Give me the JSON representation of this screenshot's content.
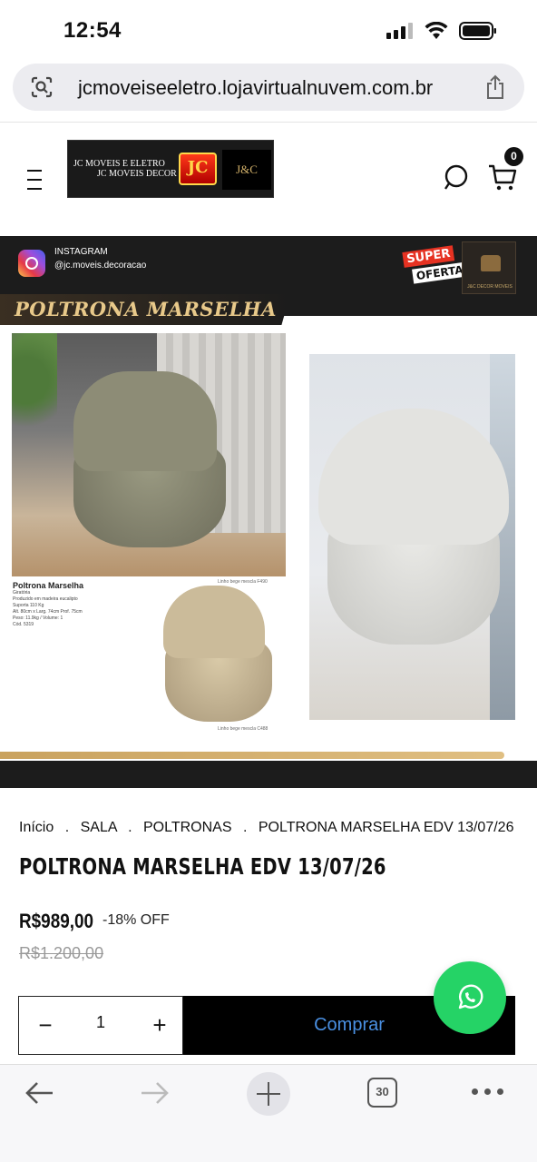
{
  "status_bar": {
    "time": "12:54"
  },
  "browser": {
    "url": "jcmoveiseeletro.lojavirtualnuvem.com.br",
    "tabs_count": "30"
  },
  "header": {
    "logo_line1": "JC MOVEIS E ELETRO",
    "logo_line2": "JC MOVEIS DECOR",
    "logo_mark": "JC",
    "logo_mark2": "J&C",
    "cart_count": "0"
  },
  "product_image": {
    "instagram_label": "INSTAGRAM",
    "instagram_handle": "@jc.moveis.decoracao",
    "promo_line1": "SUPER",
    "promo_line2": "OFERTA",
    "decor_logo_text": "J&C DECOR MOVEIS",
    "banner_title": "POLTRONA MARSELHA",
    "spec_title": "Poltrona Marselha",
    "spec_lines": [
      "Giratória",
      "Produzido em madeira eucalipto",
      "Suporta 110 Kg",
      "Alt. 80cm x Larg. 74cm Prof. 75cm",
      "Peso: 11.9kg / Volume: 1",
      "Cód. 5319"
    ],
    "caption_top": "Linho bege mescla F490",
    "caption_bottom": "Linho bege mescla C488"
  },
  "breadcrumb": {
    "items": [
      "Início",
      "SALA",
      "POLTRONAS",
      "POLTRONA MARSELHA EDV 13/07/26"
    ],
    "separator": "."
  },
  "product": {
    "title": "POLTRONA MARSELHA EDV 13/07/26",
    "price": "R$989,00",
    "discount": "-18% OFF",
    "old_price": "R$1.200,00"
  },
  "purchase": {
    "quantity": "1",
    "minus_label": "−",
    "plus_label": "+",
    "buy_label": "Comprar"
  },
  "colors": {
    "whatsapp": "#25d366",
    "buy_text": "#4a90e2",
    "banner_gold": "#e8c98a"
  }
}
